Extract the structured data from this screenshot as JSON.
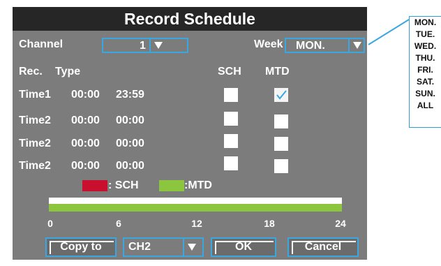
{
  "dialog": {
    "title": "Record Schedule"
  },
  "header": {
    "channel_label": "Channel",
    "channel_value": "1",
    "week_label": "Week",
    "week_value": "MON."
  },
  "columns": {
    "rec": "Rec.",
    "type": "Type",
    "sch": "SCH",
    "mtd": "MTD"
  },
  "rows": [
    {
      "name": "Time1",
      "start": "00:00",
      "end": "23:59",
      "sch": false,
      "mtd": true
    },
    {
      "name": "Time2",
      "start": "00:00",
      "end": "00:00",
      "sch": false,
      "mtd": false
    },
    {
      "name": "Time2",
      "start": "00:00",
      "end": "00:00",
      "sch": false,
      "mtd": false
    },
    {
      "name": "Time2",
      "start": "00:00",
      "end": "00:00",
      "sch": false,
      "mtd": false
    }
  ],
  "legend": {
    "sch_label": ": SCH",
    "mtd_label": ":MTD",
    "sch_color": "#c8102e",
    "mtd_color": "#8cc63f"
  },
  "timeline": {
    "ticks": [
      "0",
      "6",
      "12",
      "18",
      "24"
    ],
    "mtd_fraction": 1.0
  },
  "buttons": {
    "copy_to": "Copy to",
    "copy_channel": "CH2",
    "ok": "OK",
    "cancel": "Cancel"
  },
  "week_dropdown": {
    "options": [
      "MON.",
      "TUE.",
      "WED.",
      "THU.",
      "FRI.",
      "SAT.",
      "SUN.",
      "ALL"
    ]
  },
  "colors": {
    "accent": "#3aa7e0",
    "panel": "#7c7c7c",
    "titlebar": "#262626"
  }
}
